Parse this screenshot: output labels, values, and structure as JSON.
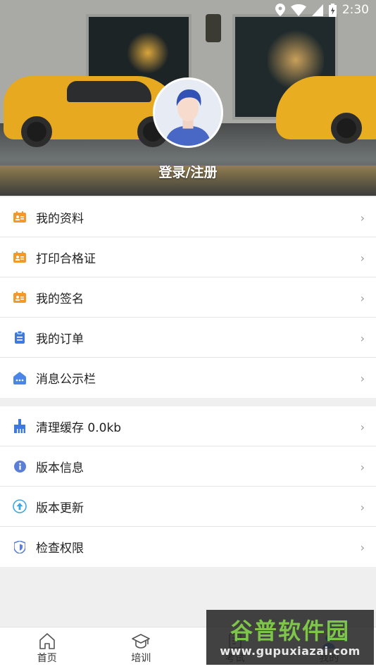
{
  "status_bar": {
    "time": "2:30"
  },
  "profile": {
    "login_label": "登录/注册"
  },
  "menu_group_1": [
    {
      "label": "我的资料",
      "icon": "profile-card-icon",
      "color": "#f19a2b"
    },
    {
      "label": "打印合格证",
      "icon": "certificate-icon",
      "color": "#f19a2b"
    },
    {
      "label": "我的签名",
      "icon": "signature-icon",
      "color": "#f19a2b"
    },
    {
      "label": "我的订单",
      "icon": "order-clipboard-icon",
      "color": "#3f78e0"
    },
    {
      "label": "消息公示栏",
      "icon": "message-board-icon",
      "color": "#4a86e8"
    }
  ],
  "menu_group_2": [
    {
      "label": "清理缓存 0.0kb",
      "icon": "broom-icon",
      "color": "#3f78e0"
    },
    {
      "label": "版本信息",
      "icon": "info-icon",
      "color": "#5b7fd6"
    },
    {
      "label": "版本更新",
      "icon": "upgrade-arrow-icon",
      "color": "#3fa7e0"
    },
    {
      "label": "检查权限",
      "icon": "shield-icon",
      "color": "#5b7fd6"
    }
  ],
  "bottom_nav": [
    {
      "label": "首页",
      "icon": "home-icon"
    },
    {
      "label": "培训",
      "icon": "graduation-cap-icon"
    },
    {
      "label": "考试",
      "icon": "exam-icon"
    },
    {
      "label": "我的",
      "icon": "user-icon"
    }
  ],
  "watermark": {
    "title": "谷普软件园",
    "url": "www.gupuxiazai.com"
  }
}
